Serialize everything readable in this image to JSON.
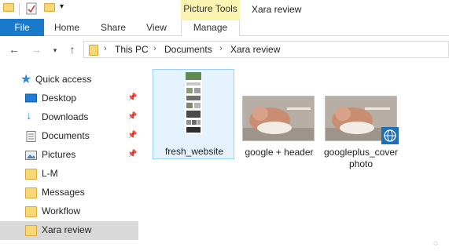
{
  "window": {
    "title": "Xara review",
    "contextual_group": "Picture Tools"
  },
  "ribbon": {
    "tabs": [
      {
        "label": "File"
      },
      {
        "label": "Home"
      },
      {
        "label": "Share"
      },
      {
        "label": "View"
      },
      {
        "label": "Manage"
      }
    ]
  },
  "address": {
    "crumbs": [
      "This PC",
      "Documents",
      "Xara review"
    ]
  },
  "sidebar": {
    "items": [
      {
        "label": "Quick access",
        "icon": "star-icon",
        "pinned": false
      },
      {
        "label": "Desktop",
        "icon": "desktop-icon",
        "pinned": true
      },
      {
        "label": "Downloads",
        "icon": "download-icon",
        "pinned": true
      },
      {
        "label": "Documents",
        "icon": "documents-icon",
        "pinned": true
      },
      {
        "label": "Pictures",
        "icon": "pictures-icon",
        "pinned": true
      },
      {
        "label": "L-M",
        "icon": "folder-icon",
        "pinned": false
      },
      {
        "label": "Messages",
        "icon": "folder-icon",
        "pinned": false
      },
      {
        "label": "Workflow",
        "icon": "folder-icon",
        "pinned": false
      },
      {
        "label": "Xara review",
        "icon": "folder-icon",
        "pinned": false,
        "selected": true
      }
    ]
  },
  "files": [
    {
      "name": "fresh_website",
      "selected": true
    },
    {
      "name": "google + header",
      "selected": false
    },
    {
      "name": "googleplus_cover photo",
      "line1": "googleplus_cover",
      "line2": "photo",
      "selected": false
    }
  ],
  "colors": {
    "accent": "#1979ca",
    "context_tab": "#fbf3b0",
    "selection": "#e5f3ff",
    "folder": "#f8d775"
  }
}
